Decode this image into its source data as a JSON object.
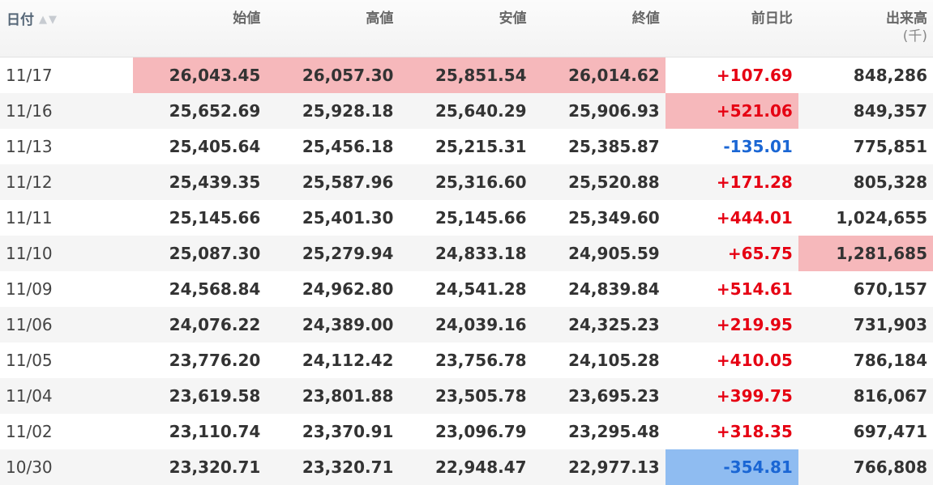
{
  "table": {
    "headers": {
      "date": "日付",
      "open": "始値",
      "high": "高値",
      "low": "安値",
      "close": "終値",
      "change": "前日比",
      "volume": "出来高",
      "volume_unit": "(千)"
    },
    "sort_icons": "sort-up-down-icon",
    "colors": {
      "up": "#e60012",
      "down": "#1a66d4",
      "highlight_red": "#f6b8bb",
      "highlight_blue": "#8fbcf1",
      "stripe": "#f5f5f5"
    },
    "rows": [
      {
        "date": "11/17",
        "open": "26,043.45",
        "high": "26,057.30",
        "low": "25,851.54",
        "close": "26,014.62",
        "change": "+107.69",
        "volume": "848,286",
        "dir": "up",
        "hl": {
          "open": "red",
          "high": "red",
          "low": "red",
          "close": "red"
        }
      },
      {
        "date": "11/16",
        "open": "25,652.69",
        "high": "25,928.18",
        "low": "25,640.29",
        "close": "25,906.93",
        "change": "+521.06",
        "volume": "849,357",
        "dir": "up",
        "hl": {
          "change": "red"
        }
      },
      {
        "date": "11/13",
        "open": "25,405.64",
        "high": "25,456.18",
        "low": "25,215.31",
        "close": "25,385.87",
        "change": "-135.01",
        "volume": "775,851",
        "dir": "down",
        "hl": {}
      },
      {
        "date": "11/12",
        "open": "25,439.35",
        "high": "25,587.96",
        "low": "25,316.60",
        "close": "25,520.88",
        "change": "+171.28",
        "volume": "805,328",
        "dir": "up",
        "hl": {}
      },
      {
        "date": "11/11",
        "open": "25,145.66",
        "high": "25,401.30",
        "low": "25,145.66",
        "close": "25,349.60",
        "change": "+444.01",
        "volume": "1,024,655",
        "dir": "up",
        "hl": {}
      },
      {
        "date": "11/10",
        "open": "25,087.30",
        "high": "25,279.94",
        "low": "24,833.18",
        "close": "24,905.59",
        "change": "+65.75",
        "volume": "1,281,685",
        "dir": "up",
        "hl": {
          "volume": "red"
        }
      },
      {
        "date": "11/09",
        "open": "24,568.84",
        "high": "24,962.80",
        "low": "24,541.28",
        "close": "24,839.84",
        "change": "+514.61",
        "volume": "670,157",
        "dir": "up",
        "hl": {}
      },
      {
        "date": "11/06",
        "open": "24,076.22",
        "high": "24,389.00",
        "low": "24,039.16",
        "close": "24,325.23",
        "change": "+219.95",
        "volume": "731,903",
        "dir": "up",
        "hl": {}
      },
      {
        "date": "11/05",
        "open": "23,776.20",
        "high": "24,112.42",
        "low": "23,756.78",
        "close": "24,105.28",
        "change": "+410.05",
        "volume": "786,184",
        "dir": "up",
        "hl": {}
      },
      {
        "date": "11/04",
        "open": "23,619.58",
        "high": "23,801.88",
        "low": "23,505.78",
        "close": "23,695.23",
        "change": "+399.75",
        "volume": "816,067",
        "dir": "up",
        "hl": {}
      },
      {
        "date": "11/02",
        "open": "23,110.74",
        "high": "23,370.91",
        "low": "23,096.79",
        "close": "23,295.48",
        "change": "+318.35",
        "volume": "697,471",
        "dir": "up",
        "hl": {}
      },
      {
        "date": "10/30",
        "open": "23,320.71",
        "high": "23,320.71",
        "low": "22,948.47",
        "close": "22,977.13",
        "change": "-354.81",
        "volume": "766,808",
        "dir": "down",
        "hl": {
          "change": "blue"
        }
      }
    ]
  }
}
